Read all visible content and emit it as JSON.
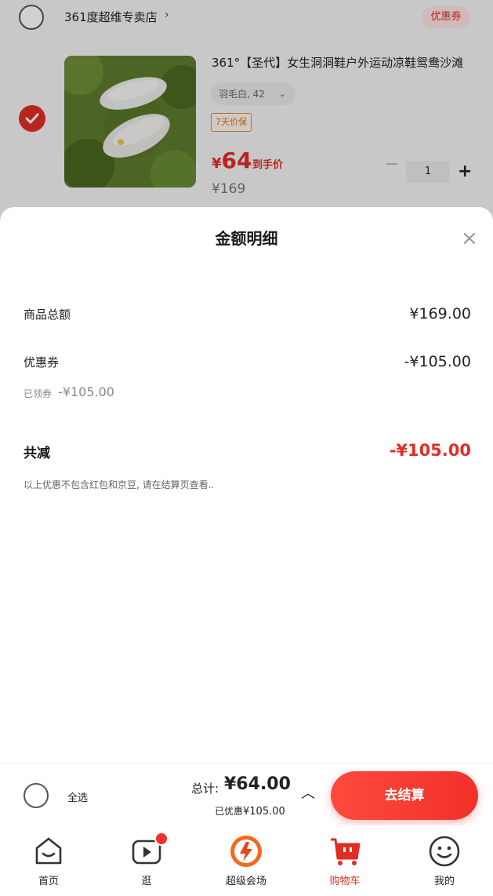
{
  "store": {
    "name": "361度超维专卖店",
    "chevron": "›",
    "coupon_button": "优惠券"
  },
  "product": {
    "title": "361°【圣代】女生洞洞鞋户外运动凉鞋鸳鸯沙滩",
    "spec": "羽毛白, 42",
    "spec_chevron": "⌄",
    "guarantee": "7天价保",
    "price_symbol": "¥",
    "price": "64",
    "price_tag": "到手价",
    "original_price": "¥169",
    "quantity": "1",
    "plus": "+"
  },
  "sheet": {
    "title": "金额明细",
    "close": "×",
    "goods_total_label": "商品总额",
    "goods_total_value": "¥169.00",
    "coupon_label": "优惠券",
    "coupon_value": "-¥105.00",
    "claimed_coupon_label": "已领券",
    "claimed_coupon_value": "-¥105.00",
    "total_reduce_label": "共减",
    "total_reduce_value": "-¥105.00",
    "note": "以上优惠不包含红包和京豆, 请在结算页查看.."
  },
  "checkout": {
    "select_all": "全选",
    "total_prefix": "总计:",
    "total_amount": "¥64.00",
    "saved_prefix": "已优惠",
    "saved_amount": "¥105.00",
    "caret": "︿",
    "button": "去结算"
  },
  "tabbar": {
    "items": [
      {
        "label": "首页",
        "icon": "home-icon"
      },
      {
        "label": "逛",
        "icon": "video-play-icon"
      },
      {
        "label": "超级会场",
        "icon": "super-venue-icon"
      },
      {
        "label": "购物车",
        "icon": "cart-icon"
      },
      {
        "label": "我的",
        "icon": "profile-icon"
      }
    ],
    "active_index": 3
  },
  "colors": {
    "accent": "#e02e24",
    "coupon_bg": "#fde3e3",
    "guarantee": "#d9781e"
  }
}
